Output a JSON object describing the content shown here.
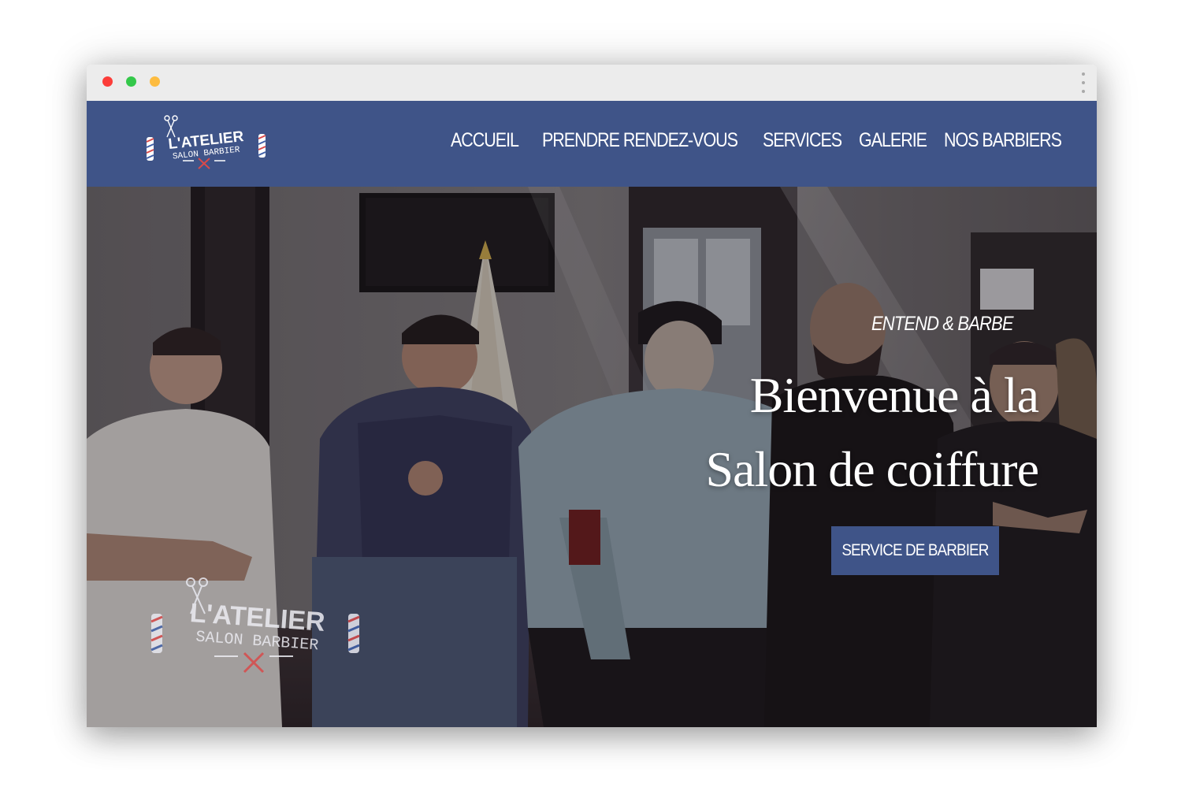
{
  "window": {
    "controls": [
      "close",
      "minimize",
      "zoom"
    ]
  },
  "header": {
    "logo_line1": "L'ATELIER",
    "logo_line2": "SALON BARBIER",
    "background": "#3f5488"
  },
  "nav": {
    "items": [
      {
        "label": "ACCUEIL"
      },
      {
        "label": "PRENDRE RENDEZ-VOUS"
      },
      {
        "label": "SERVICES"
      },
      {
        "label": "GALERIE"
      },
      {
        "label": "NOS BARBIERS"
      }
    ]
  },
  "hero": {
    "eyebrow": "ENTEND & BARBE",
    "headline_line1": "Bienvenue à la",
    "headline_line2": "Salon de coiffure",
    "cta_label": "SERVICE DE BARBIER",
    "watermark_line1": "L'ATELIER",
    "watermark_line2": "SALON BARBIER"
  },
  "colors": {
    "brand": "#3f5488",
    "text_on_brand": "#ffffff",
    "pole_red": "#d94a4a",
    "pole_blue": "#4060a8"
  }
}
